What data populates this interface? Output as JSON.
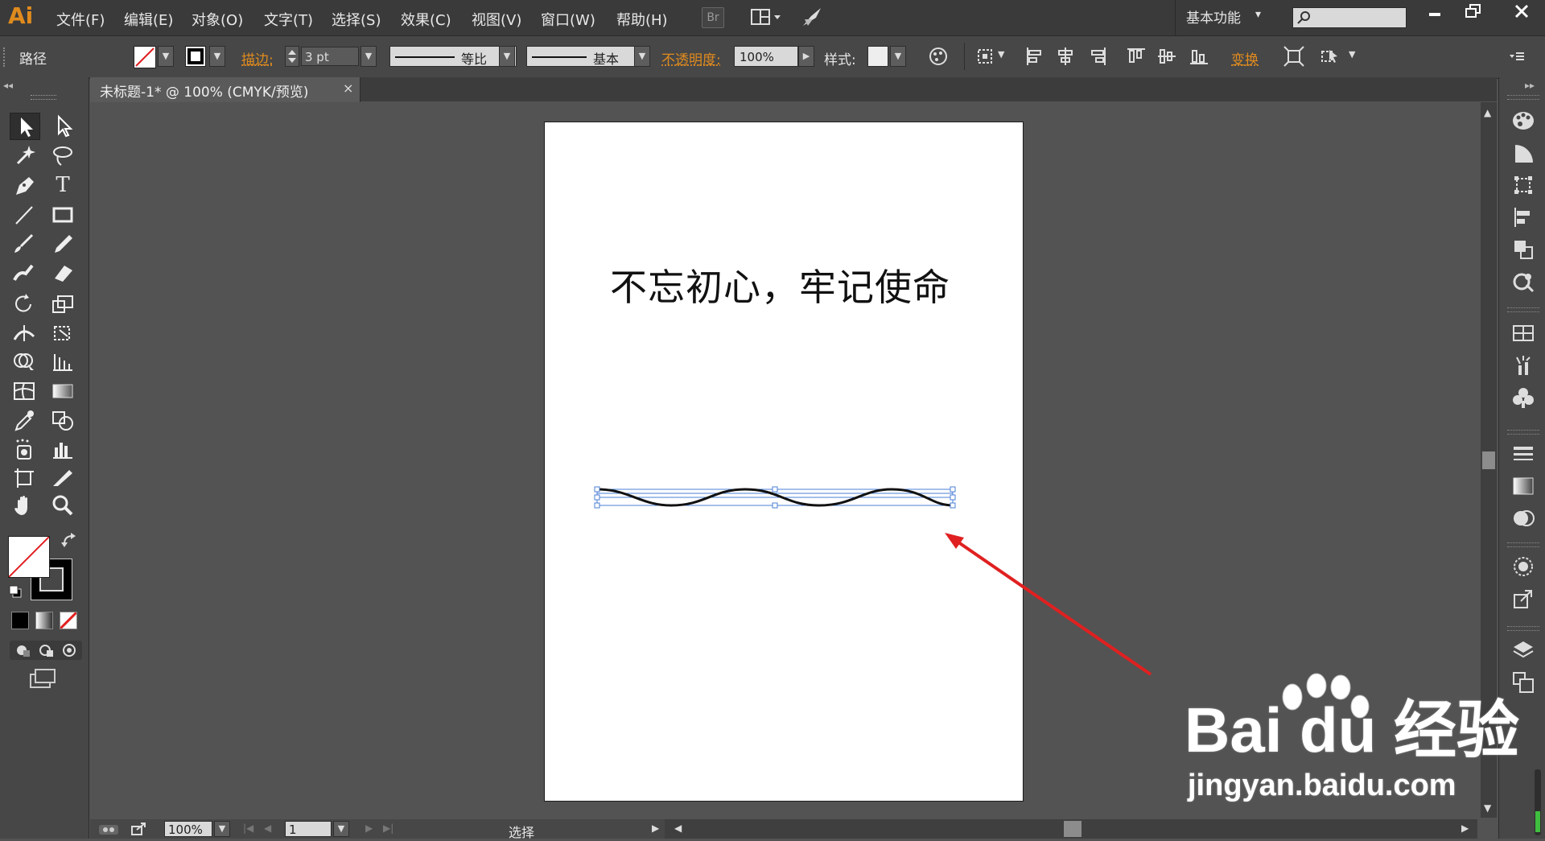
{
  "app": {
    "logo": "Ai"
  },
  "menu": {
    "items": [
      "文件(F)",
      "编辑(E)",
      "对象(O)",
      "文字(T)",
      "选择(S)",
      "效果(C)",
      "视图(V)",
      "窗口(W)",
      "帮助(H)"
    ],
    "br_label": "Br",
    "workspace": "基本功能",
    "workspace_arrow": "▾"
  },
  "control_bar": {
    "selection_type": "路径",
    "stroke_label": "描边:",
    "stroke_weight": "3 pt",
    "profile_label": "等比",
    "brush_label": "基本",
    "opacity_label": "不透明度:",
    "opacity_value": "100%",
    "style_label": "样式:",
    "transform_label": "变换"
  },
  "document": {
    "tab_title": "未标题-1* @ 100% (CMYK/预览)",
    "close_glyph": "×"
  },
  "artboard": {
    "headline": "不忘初心，牢记使命"
  },
  "status": {
    "zoom": "100%",
    "artboard_number": "1",
    "tool_name": "选择"
  },
  "watermark": {
    "logo_text": "Bai du 经验",
    "url": "jingyan.baidu.com"
  },
  "colors": {
    "accent_orange": "#e08b1e",
    "arrow_red": "#e02020",
    "selection_blue": "#4a7fd6"
  }
}
